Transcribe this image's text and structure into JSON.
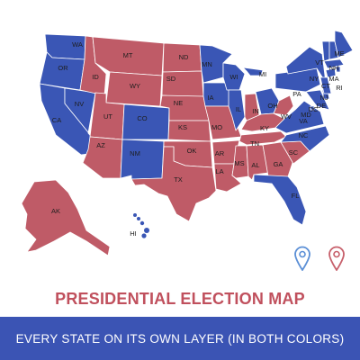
{
  "map": {
    "colors": {
      "democrat": "#3a56b5",
      "republican": "#bf5b67"
    },
    "states": [
      {
        "id": "WA",
        "party": "D"
      },
      {
        "id": "OR",
        "party": "D"
      },
      {
        "id": "CA",
        "party": "D"
      },
      {
        "id": "NV",
        "party": "D"
      },
      {
        "id": "ID",
        "party": "R"
      },
      {
        "id": "MT",
        "party": "R"
      },
      {
        "id": "WY",
        "party": "R"
      },
      {
        "id": "UT",
        "party": "R"
      },
      {
        "id": "AZ",
        "party": "R"
      },
      {
        "id": "CO",
        "party": "D"
      },
      {
        "id": "NM",
        "party": "D"
      },
      {
        "id": "ND",
        "party": "R"
      },
      {
        "id": "SD",
        "party": "R"
      },
      {
        "id": "NE",
        "party": "R"
      },
      {
        "id": "KS",
        "party": "R"
      },
      {
        "id": "OK",
        "party": "R"
      },
      {
        "id": "TX",
        "party": "R"
      },
      {
        "id": "MN",
        "party": "D"
      },
      {
        "id": "IA",
        "party": "D"
      },
      {
        "id": "MO",
        "party": "R"
      },
      {
        "id": "AR",
        "party": "R"
      },
      {
        "id": "LA",
        "party": "R"
      },
      {
        "id": "WI",
        "party": "D"
      },
      {
        "id": "IL",
        "party": "D"
      },
      {
        "id": "MS",
        "party": "R"
      },
      {
        "id": "MI",
        "party": "D"
      },
      {
        "id": "IN",
        "party": "R"
      },
      {
        "id": "OH",
        "party": "D"
      },
      {
        "id": "KY",
        "party": "R"
      },
      {
        "id": "TN",
        "party": "R"
      },
      {
        "id": "AL",
        "party": "R"
      },
      {
        "id": "GA",
        "party": "R"
      },
      {
        "id": "FL",
        "party": "D"
      },
      {
        "id": "SC",
        "party": "R"
      },
      {
        "id": "NC",
        "party": "D"
      },
      {
        "id": "VA",
        "party": "D"
      },
      {
        "id": "WV",
        "party": "R"
      },
      {
        "id": "PA",
        "party": "D"
      },
      {
        "id": "NY",
        "party": "D"
      },
      {
        "id": "MD",
        "party": "D"
      },
      {
        "id": "DE",
        "party": "D"
      },
      {
        "id": "NJ",
        "party": "D"
      },
      {
        "id": "CT",
        "party": "D"
      },
      {
        "id": "RI",
        "party": "D"
      },
      {
        "id": "MA",
        "party": "D"
      },
      {
        "id": "VT",
        "party": "D"
      },
      {
        "id": "NH",
        "party": "D"
      },
      {
        "id": "ME",
        "party": "D"
      },
      {
        "id": "AK",
        "party": "R"
      },
      {
        "id": "HI",
        "party": "D"
      },
      {
        "id": "DC",
        "party": "D"
      }
    ],
    "labels": [
      "WA",
      "OR",
      "CA",
      "NV",
      "ID",
      "MT",
      "WY",
      "UT",
      "AZ",
      "CO",
      "NM",
      "ND",
      "SD",
      "NE",
      "KS",
      "OK",
      "TX",
      "MN",
      "IA",
      "MO",
      "AR",
      "LA",
      "WI",
      "IL",
      "MS",
      "MI",
      "IN",
      "OH",
      "KY",
      "TN",
      "AL",
      "GA",
      "FL",
      "SC",
      "NC",
      "VA",
      "WV",
      "PA",
      "NY",
      "MD",
      "DE",
      "NJ",
      "CT",
      "RI",
      "MA",
      "VT",
      "NH",
      "ME",
      "AK",
      "HI",
      "DC"
    ]
  },
  "legend": {
    "markers": [
      {
        "icon": "map-pin-icon",
        "color": "#5b8fd6"
      },
      {
        "icon": "map-pin-icon",
        "color": "#c7606b"
      }
    ]
  },
  "title": "PRESIDENTIAL ELECTION MAP",
  "subtitle": "EVERY STATE ON ITS OWN LAYER (IN BOTH COLORS)"
}
